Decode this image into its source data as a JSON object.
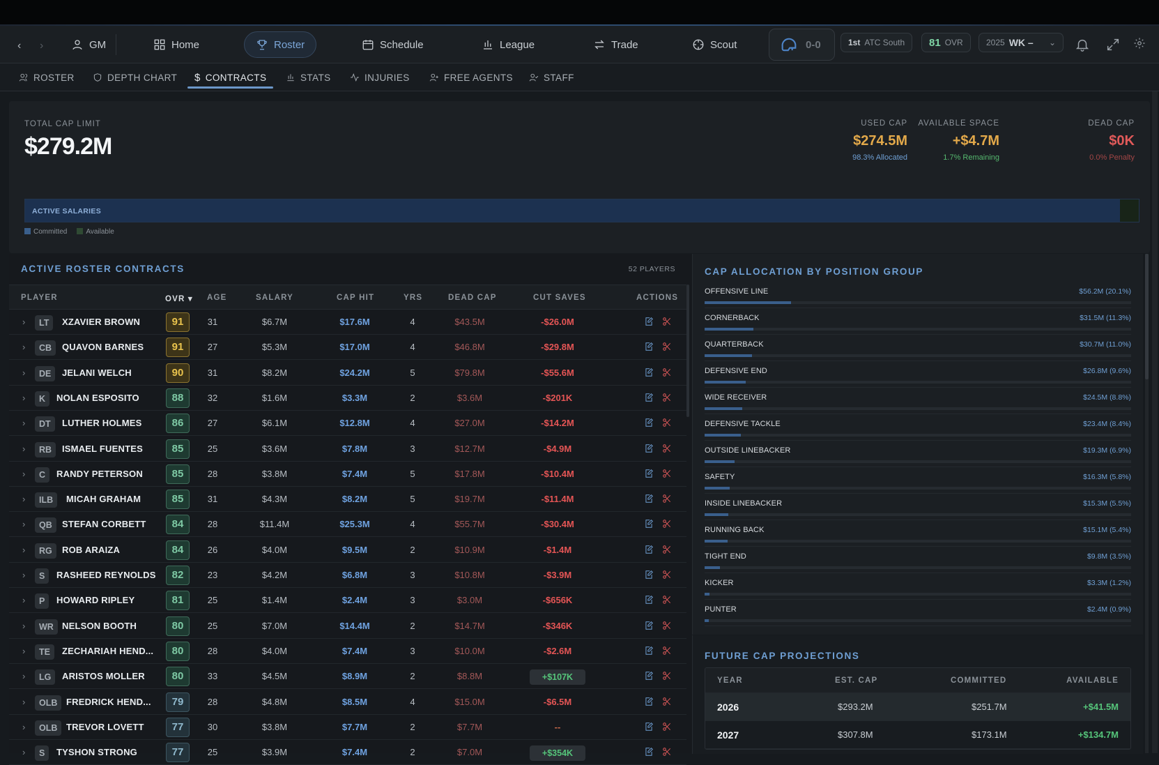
{
  "nav": {
    "back": "‹",
    "forward": "›",
    "gm": "GM",
    "home": "Home",
    "roster": "Roster",
    "schedule": "Schedule",
    "league": "League",
    "trade": "Trade",
    "scout": "Scout",
    "record": "0-0",
    "rank": "1st",
    "division": "ATC South",
    "ovr_value": "81",
    "ovr_label": "OVR",
    "season": "2025",
    "week": "WK –"
  },
  "subnav": {
    "roster": "ROSTER",
    "depth": "DEPTH CHART",
    "contracts": "CONTRACTS",
    "stats": "STATS",
    "injuries": "INJURIES",
    "free_agents": "FREE AGENTS",
    "staff": "STAFF"
  },
  "cap": {
    "limit_label": "TOTAL CAP LIMIT",
    "limit": "$279.2M",
    "used_label": "USED CAP",
    "used": "$274.5M",
    "used_sub": "98.3% Allocated",
    "avail_label": "AVAILABLE SPACE",
    "avail": "+$4.7M",
    "avail_sub": "1.7% Remaining",
    "dead_label": "DEAD CAP",
    "dead": "$0K",
    "dead_sub": "0.0% Penalty",
    "bar_label": "ACTIVE SALARIES",
    "committed_fraction": 0.983,
    "legend_committed": "Committed",
    "legend_available": "Available"
  },
  "roster": {
    "title": "ACTIVE ROSTER CONTRACTS",
    "count": "52 PLAYERS",
    "headers": {
      "player": "PLAYER",
      "ovr": "OVR ▾",
      "age": "AGE",
      "salary": "SALARY",
      "cap_hit": "CAP HIT",
      "yrs": "YRS",
      "dead_cap": "DEAD CAP",
      "cut_saves": "CUT SAVES",
      "actions": "ACTIONS"
    },
    "rows": [
      {
        "pos": "LT",
        "name": "XZAVIER BROWN",
        "ovr": "91",
        "age": "31",
        "salary": "$6.7M",
        "cap_hit": "$17.6M",
        "yrs": "4",
        "dead": "$43.5M",
        "cut": "-$26.0M"
      },
      {
        "pos": "CB",
        "name": "QUAVON BARNES",
        "ovr": "91",
        "age": "27",
        "salary": "$5.3M",
        "cap_hit": "$17.0M",
        "yrs": "4",
        "dead": "$46.8M",
        "cut": "-$29.8M"
      },
      {
        "pos": "DE",
        "name": "JELANI WELCH",
        "ovr": "90",
        "age": "31",
        "salary": "$8.2M",
        "cap_hit": "$24.2M",
        "yrs": "5",
        "dead": "$79.8M",
        "cut": "-$55.6M"
      },
      {
        "pos": "K",
        "name": "NOLAN ESPOSITO",
        "ovr": "88",
        "age": "32",
        "salary": "$1.6M",
        "cap_hit": "$3.3M",
        "yrs": "2",
        "dead": "$3.6M",
        "cut": "-$201K"
      },
      {
        "pos": "DT",
        "name": "LUTHER HOLMES",
        "ovr": "86",
        "age": "27",
        "salary": "$6.1M",
        "cap_hit": "$12.8M",
        "yrs": "4",
        "dead": "$27.0M",
        "cut": "-$14.2M"
      },
      {
        "pos": "RB",
        "name": "ISMAEL FUENTES",
        "ovr": "85",
        "age": "25",
        "salary": "$3.6M",
        "cap_hit": "$7.8M",
        "yrs": "3",
        "dead": "$12.7M",
        "cut": "-$4.9M"
      },
      {
        "pos": "C",
        "name": "RANDY PETERSON",
        "ovr": "85",
        "age": "28",
        "salary": "$3.8M",
        "cap_hit": "$7.4M",
        "yrs": "5",
        "dead": "$17.8M",
        "cut": "-$10.4M"
      },
      {
        "pos": "ILB",
        "name": "MICAH GRAHAM",
        "ovr": "85",
        "age": "31",
        "salary": "$4.3M",
        "cap_hit": "$8.2M",
        "yrs": "5",
        "dead": "$19.7M",
        "cut": "-$11.4M"
      },
      {
        "pos": "QB",
        "name": "STEFAN CORBETT",
        "ovr": "84",
        "age": "28",
        "salary": "$11.4M",
        "cap_hit": "$25.3M",
        "yrs": "4",
        "dead": "$55.7M",
        "cut": "-$30.4M"
      },
      {
        "pos": "RG",
        "name": "ROB ARAIZA",
        "ovr": "84",
        "age": "26",
        "salary": "$4.0M",
        "cap_hit": "$9.5M",
        "yrs": "2",
        "dead": "$10.9M",
        "cut": "-$1.4M"
      },
      {
        "pos": "S",
        "name": "RASHEED REYNOLDS",
        "ovr": "82",
        "age": "23",
        "salary": "$4.2M",
        "cap_hit": "$6.8M",
        "yrs": "3",
        "dead": "$10.8M",
        "cut": "-$3.9M"
      },
      {
        "pos": "P",
        "name": "HOWARD RIPLEY",
        "ovr": "81",
        "age": "25",
        "salary": "$1.4M",
        "cap_hit": "$2.4M",
        "yrs": "3",
        "dead": "$3.0M",
        "cut": "-$656K"
      },
      {
        "pos": "WR",
        "name": "NELSON BOOTH",
        "ovr": "80",
        "age": "25",
        "salary": "$7.0M",
        "cap_hit": "$14.4M",
        "yrs": "2",
        "dead": "$14.7M",
        "cut": "-$346K"
      },
      {
        "pos": "TE",
        "name": "ZECHARIAH HEND...",
        "ovr": "80",
        "age": "28",
        "salary": "$4.0M",
        "cap_hit": "$7.4M",
        "yrs": "3",
        "dead": "$10.0M",
        "cut": "-$2.6M"
      },
      {
        "pos": "LG",
        "name": "ARISTOS MOLLER",
        "ovr": "80",
        "age": "33",
        "salary": "$4.5M",
        "cap_hit": "$8.9M",
        "yrs": "2",
        "dead": "$8.8M",
        "cut": "+$107K"
      },
      {
        "pos": "OLB",
        "name": "FREDRICK HEND...",
        "ovr": "79",
        "age": "28",
        "salary": "$4.8M",
        "cap_hit": "$8.5M",
        "yrs": "4",
        "dead": "$15.0M",
        "cut": "-$6.5M"
      },
      {
        "pos": "OLB",
        "name": "TREVOR LOVETT",
        "ovr": "77",
        "age": "30",
        "salary": "$3.8M",
        "cap_hit": "$7.7M",
        "yrs": "2",
        "dead": "$7.7M",
        "cut": "--"
      },
      {
        "pos": "S",
        "name": "TYSHON STRONG",
        "ovr": "77",
        "age": "25",
        "salary": "$3.9M",
        "cap_hit": "$7.4M",
        "yrs": "2",
        "dead": "$7.0M",
        "cut": "+$354K"
      }
    ]
  },
  "alloc": {
    "title": "CAP ALLOCATION BY POSITION GROUP",
    "items": [
      {
        "name": "OFFENSIVE LINE",
        "value": "$56.2M (20.1%)",
        "pct": 20.1
      },
      {
        "name": "CORNERBACK",
        "value": "$31.5M (11.3%)",
        "pct": 11.3
      },
      {
        "name": "QUARTERBACK",
        "value": "$30.7M (11.0%)",
        "pct": 11.0
      },
      {
        "name": "DEFENSIVE END",
        "value": "$26.8M (9.6%)",
        "pct": 9.6
      },
      {
        "name": "WIDE RECEIVER",
        "value": "$24.5M (8.8%)",
        "pct": 8.8
      },
      {
        "name": "DEFENSIVE TACKLE",
        "value": "$23.4M (8.4%)",
        "pct": 8.4
      },
      {
        "name": "OUTSIDE LINEBACKER",
        "value": "$19.3M (6.9%)",
        "pct": 6.9
      },
      {
        "name": "SAFETY",
        "value": "$16.3M (5.8%)",
        "pct": 5.8
      },
      {
        "name": "INSIDE LINEBACKER",
        "value": "$15.3M (5.5%)",
        "pct": 5.5
      },
      {
        "name": "RUNNING BACK",
        "value": "$15.1M (5.4%)",
        "pct": 5.4
      },
      {
        "name": "TIGHT END",
        "value": "$9.8M (3.5%)",
        "pct": 3.5
      },
      {
        "name": "KICKER",
        "value": "$3.3M (1.2%)",
        "pct": 1.2
      },
      {
        "name": "PUNTER",
        "value": "$2.4M (0.9%)",
        "pct": 0.9
      }
    ]
  },
  "future": {
    "title": "FUTURE CAP PROJECTIONS",
    "headers": {
      "year": "YEAR",
      "est": "EST. CAP",
      "committed": "COMMITTED",
      "available": "AVAILABLE"
    },
    "rows": [
      {
        "year": "2026",
        "est": "$293.2M",
        "committed": "$251.7M",
        "available": "+$41.5M"
      },
      {
        "year": "2027",
        "est": "$307.8M",
        "committed": "$173.1M",
        "available": "+$134.7M"
      }
    ]
  }
}
